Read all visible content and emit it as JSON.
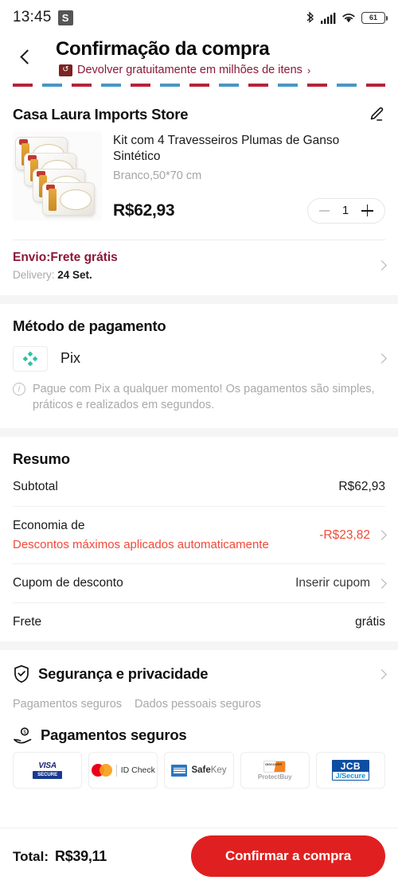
{
  "status_bar": {
    "clock": "13:45",
    "app_badge": "S",
    "bluetooth_icon": "bluetooth-icon",
    "signal_icon": "cellular-signal-icon",
    "wifi_icon": "wifi-icon",
    "battery_level": "61"
  },
  "header": {
    "back_icon": "back-chevron-icon",
    "title": "Confirmação da compra",
    "return_icon": "return-box-icon",
    "return_glyph": "↺",
    "return_text": "Devolver gratuitamente em milhões de itens",
    "return_arrow": "›"
  },
  "store": {
    "name": "Casa Laura Imports Store",
    "edit_icon": "pencil-edit-icon"
  },
  "product": {
    "image_alt": "product-image-pillows",
    "title": "Kit com 4 Travesseiros Plumas de Ganso Sintético",
    "variant": "Branco,50*70 cm",
    "price": "R$62,93",
    "quantity": "1",
    "minus_label": "-",
    "plus_label": "+"
  },
  "shipping": {
    "title": "Envio:Frete grátis",
    "delivery_prefix": "Delivery:",
    "delivery_date": "24 Set."
  },
  "payment": {
    "section_title": "Método de pagamento",
    "method_icon": "pix-logo-icon",
    "method_label": "Pix",
    "info_glyph": "i",
    "note": "Pague com Pix a qualquer momento! Os pagamentos são simples, práticos e realizados em segundos."
  },
  "summary": {
    "section_title": "Resumo",
    "rows": [
      {
        "label": "Subtotal",
        "sublabel": "",
        "value": "R$62,93",
        "has_arrow": false,
        "value_red": false
      },
      {
        "label": "Economia de",
        "sublabel": "Descontos máximos aplicados automaticamente",
        "value": "-R$23,82",
        "has_arrow": true,
        "value_red": true
      },
      {
        "label": "Cupom de desconto",
        "sublabel": "",
        "value": "Inserir cupom",
        "has_arrow": true,
        "value_red": false
      },
      {
        "label": "Frete",
        "sublabel": "",
        "value": "grátis",
        "has_arrow": false,
        "value_red": false
      }
    ]
  },
  "security": {
    "shield_icon": "shield-check-icon",
    "title": "Segurança e privacidade",
    "tags": [
      "Pagamentos seguros",
      "Dados pessoais seguros"
    ],
    "safe_icon": "hand-coin-icon",
    "safe_title": "Pagamentos seguros",
    "badges": [
      {
        "name": "visa-secure-badge",
        "top": "VISA",
        "bottom": "SECURE"
      },
      {
        "name": "mastercard-id-check-badge",
        "text": "ID Check"
      },
      {
        "name": "amex-safekey-badge",
        "text": "Safe",
        "text2": "Key"
      },
      {
        "name": "discover-protectbuy-badge",
        "top": "DISCOVER",
        "bottom": "ProtectBuy"
      },
      {
        "name": "jcb-jsecure-badge",
        "top": "JCB",
        "bottom": "J/Secure"
      }
    ]
  },
  "bottom": {
    "total_label": "Total:",
    "total_value": "R$39,11",
    "confirm_label": "Confirmar a compra"
  },
  "colors": {
    "brand_red": "#E02020",
    "discount_red": "#F04A37",
    "shipping_maroon": "#8B1838",
    "pix_teal": "#31BFA5"
  }
}
